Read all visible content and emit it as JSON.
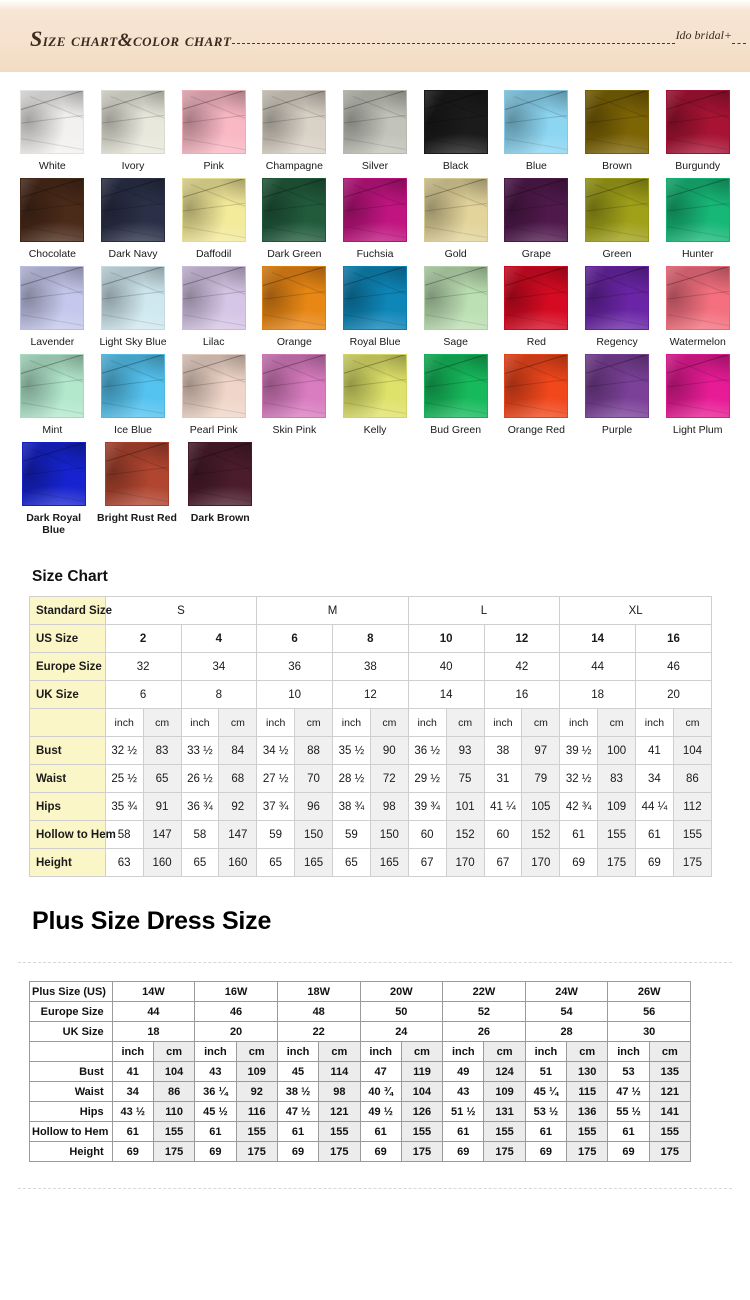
{
  "header": {
    "title": "SIZE CHART&COLOR CHART",
    "brand": "Ido bridal+"
  },
  "colors": {
    "swatches": [
      {
        "name": "White",
        "hex": "#f3f1ef"
      },
      {
        "name": "Ivory",
        "hex": "#e9e8dc"
      },
      {
        "name": "Pink",
        "hex": "#f9b8c4"
      },
      {
        "name": "Champagne",
        "hex": "#d9d2c6"
      },
      {
        "name": "Silver",
        "hex": "#c2c3b9"
      },
      {
        "name": "Black",
        "hex": "#1b1b1b"
      },
      {
        "name": "Blue",
        "hex": "#8dd6f2"
      },
      {
        "name": "Brown",
        "hex": "#7d6405"
      },
      {
        "name": "Burgundy",
        "hex": "#a81334"
      },
      {
        "name": "Chocolate",
        "hex": "#4a2a19"
      },
      {
        "name": "Dark Navy",
        "hex": "#2b3048"
      },
      {
        "name": "Daffodil",
        "hex": "#f3ea9a"
      },
      {
        "name": "Dark Green",
        "hex": "#215b3c"
      },
      {
        "name": "Fuchsia",
        "hex": "#c01480"
      },
      {
        "name": "Gold",
        "hex": "#e2d49b"
      },
      {
        "name": "Grape",
        "hex": "#50194c"
      },
      {
        "name": "Green",
        "hex": "#a0a119"
      },
      {
        "name": "Hunter",
        "hex": "#17b877"
      },
      {
        "name": "Lavender",
        "hex": "#c5c8ec"
      },
      {
        "name": "Light Sky Blue",
        "hex": "#cfe8ef"
      },
      {
        "name": "Lilac",
        "hex": "#d6c5e6"
      },
      {
        "name": "Orange",
        "hex": "#e98715"
      },
      {
        "name": "Royal Blue",
        "hex": "#0e86b8"
      },
      {
        "name": "Sage",
        "hex": "#bcdfb3"
      },
      {
        "name": "Red",
        "hex": "#d60a22"
      },
      {
        "name": "Regency",
        "hex": "#6a25a6"
      },
      {
        "name": "Watermelon",
        "hex": "#f4707f"
      },
      {
        "name": "Mint",
        "hex": "#b3e8cd"
      },
      {
        "name": "Ice Blue",
        "hex": "#55c3ef"
      },
      {
        "name": "Pearl Pink",
        "hex": "#f0d6c9"
      },
      {
        "name": "Skin Pink",
        "hex": "#d97cc0"
      },
      {
        "name": "Kelly",
        "hex": "#dfe26a"
      },
      {
        "name": "Bud Green",
        "hex": "#16ba5c"
      },
      {
        "name": "Orange Red",
        "hex": "#f1471c"
      },
      {
        "name": "Purple",
        "hex": "#7b4098"
      },
      {
        "name": "Light Plum",
        "hex": "#e81b96"
      },
      {
        "name": "Dark Royal Blue",
        "hex": "#1623cf"
      },
      {
        "name": "Bright Rust Red",
        "hex": "#b04530"
      },
      {
        "name": "Dark Brown",
        "hex": "#4b1c2c"
      }
    ]
  },
  "size_chart": {
    "heading": "Size Chart",
    "standard_label": "Standard Size",
    "standard_groups": [
      {
        "label": "S",
        "span": 2
      },
      {
        "label": "M",
        "span": 2
      },
      {
        "label": "L",
        "span": 2
      },
      {
        "label": "XL",
        "span": 2
      }
    ],
    "rows": [
      {
        "label": "US Size",
        "values": [
          "2",
          "4",
          "6",
          "8",
          "10",
          "12",
          "14",
          "16"
        ]
      },
      {
        "label": "Europe Size",
        "values": [
          "32",
          "34",
          "36",
          "38",
          "40",
          "42",
          "44",
          "46"
        ]
      },
      {
        "label": "UK Size",
        "values": [
          "6",
          "8",
          "10",
          "12",
          "14",
          "16",
          "18",
          "20"
        ]
      }
    ],
    "unit_row": {
      "label": "",
      "units": [
        "inch",
        "cm",
        "inch",
        "cm",
        "inch",
        "cm",
        "inch",
        "cm",
        "inch",
        "cm",
        "inch",
        "cm",
        "inch",
        "cm",
        "inch",
        "cm"
      ]
    },
    "measurements": [
      {
        "label": "Bust",
        "values": [
          "32 ½",
          "83",
          "33 ½",
          "84",
          "34 ½",
          "88",
          "35 ½",
          "90",
          "36 ½",
          "93",
          "38",
          "97",
          "39 ½",
          "100",
          "41",
          "104"
        ]
      },
      {
        "label": "Waist",
        "values": [
          "25 ½",
          "65",
          "26 ½",
          "68",
          "27 ½",
          "70",
          "28 ½",
          "72",
          "29 ½",
          "75",
          "31",
          "79",
          "32 ½",
          "83",
          "34",
          "86"
        ]
      },
      {
        "label": "Hips",
        "values": [
          "35 ¾",
          "91",
          "36 ¾",
          "92",
          "37 ¾",
          "96",
          "38 ¾",
          "98",
          "39 ¾",
          "101",
          "41 ¼",
          "105",
          "42 ¾",
          "109",
          "44 ¼",
          "112"
        ]
      },
      {
        "label": "Hollow to Hem",
        "values": [
          "58",
          "147",
          "58",
          "147",
          "59",
          "150",
          "59",
          "150",
          "60",
          "152",
          "60",
          "152",
          "61",
          "155",
          "61",
          "155"
        ]
      },
      {
        "label": "Height",
        "values": [
          "63",
          "160",
          "65",
          "160",
          "65",
          "165",
          "65",
          "165",
          "67",
          "170",
          "67",
          "170",
          "69",
          "175",
          "69",
          "175"
        ]
      }
    ]
  },
  "plus_size": {
    "heading": "Plus Size Dress Size",
    "rows": [
      {
        "label": "Plus Size (US)",
        "values": [
          "14W",
          "16W",
          "18W",
          "20W",
          "22W",
          "24W",
          "26W"
        ]
      },
      {
        "label": "Europe Size",
        "values": [
          "44",
          "46",
          "48",
          "50",
          "52",
          "54",
          "56"
        ]
      },
      {
        "label": "UK Size",
        "values": [
          "18",
          "20",
          "22",
          "24",
          "26",
          "28",
          "30"
        ]
      }
    ],
    "unit_row": {
      "label": "",
      "units": [
        "inch",
        "cm",
        "inch",
        "cm",
        "inch",
        "cm",
        "inch",
        "cm",
        "inch",
        "cm",
        "inch",
        "cm",
        "inch",
        "cm"
      ]
    },
    "measurements": [
      {
        "label": "Bust",
        "values": [
          "41",
          "104",
          "43",
          "109",
          "45",
          "114",
          "47",
          "119",
          "49",
          "124",
          "51",
          "130",
          "53",
          "135"
        ]
      },
      {
        "label": "Waist",
        "values": [
          "34",
          "86",
          "36 ¼",
          "92",
          "38 ½",
          "98",
          "40 ¾",
          "104",
          "43",
          "109",
          "45 ¼",
          "115",
          "47 ½",
          "121"
        ]
      },
      {
        "label": "Hips",
        "values": [
          "43 ½",
          "110",
          "45 ½",
          "116",
          "47 ½",
          "121",
          "49 ½",
          "126",
          "51 ½",
          "131",
          "53 ½",
          "136",
          "55 ½",
          "141"
        ]
      },
      {
        "label": "Hollow to Hem",
        "values": [
          "61",
          "155",
          "61",
          "155",
          "61",
          "155",
          "61",
          "155",
          "61",
          "155",
          "61",
          "155",
          "61",
          "155"
        ]
      },
      {
        "label": "Height",
        "values": [
          "69",
          "175",
          "69",
          "175",
          "69",
          "175",
          "69",
          "175",
          "69",
          "175",
          "69",
          "175",
          "69",
          "175"
        ]
      }
    ]
  }
}
